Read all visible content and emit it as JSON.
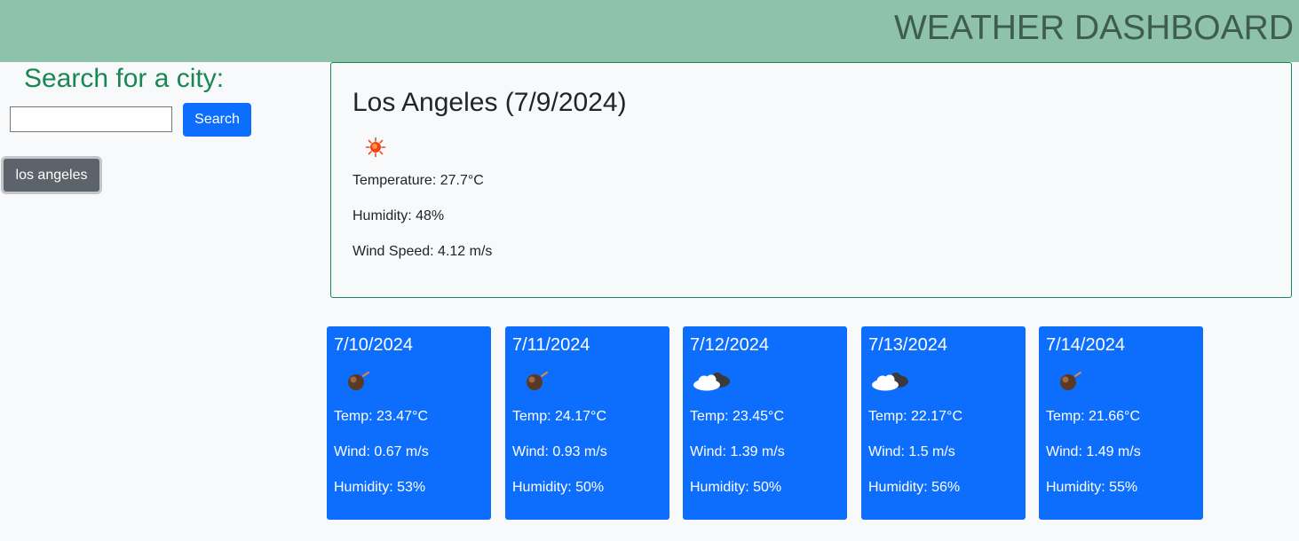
{
  "header": {
    "title": "WEATHER DASHBOARD"
  },
  "search": {
    "title": "Search for a city:",
    "input_value": "",
    "button_label": "Search"
  },
  "history": [
    {
      "label": "los angeles"
    }
  ],
  "current": {
    "heading": "Los Angeles (7/9/2024)",
    "icon": "sunny-icon",
    "temperature": "Temperature: 27.7°C",
    "humidity": "Humidity: 48%",
    "wind": "Wind Speed: 4.12 m/s"
  },
  "forecast": [
    {
      "date": "7/10/2024",
      "icon": "dark-orb-icon",
      "temp": "Temp: 23.47°C",
      "wind": "Wind: 0.67 m/s",
      "humidity": "Humidity: 53%"
    },
    {
      "date": "7/11/2024",
      "icon": "dark-orb-icon",
      "temp": "Temp: 24.17°C",
      "wind": "Wind: 0.93 m/s",
      "humidity": "Humidity: 50%"
    },
    {
      "date": "7/12/2024",
      "icon": "cloudy-icon",
      "temp": "Temp: 23.45°C",
      "wind": "Wind: 1.39 m/s",
      "humidity": "Humidity: 50%"
    },
    {
      "date": "7/13/2024",
      "icon": "cloudy-icon",
      "temp": "Temp: 22.17°C",
      "wind": "Wind: 1.5 m/s",
      "humidity": "Humidity: 56%"
    },
    {
      "date": "7/14/2024",
      "icon": "dark-orb-icon",
      "temp": "Temp: 21.66°C",
      "wind": "Wind: 1.49 m/s",
      "humidity": "Humidity: 55%"
    }
  ],
  "colors": {
    "header_bg": "#8fc2aa",
    "header_text": "#3e5c4f",
    "accent_green": "#198754",
    "primary_blue": "#0d6efd",
    "history_bg": "#5c636a"
  }
}
